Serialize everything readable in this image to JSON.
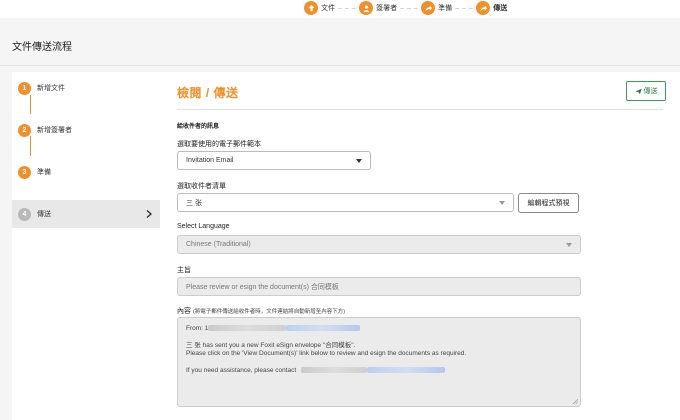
{
  "stepper": {
    "steps": [
      {
        "label": "文件",
        "icon": "document-upload-icon"
      },
      {
        "label": "簽署者",
        "icon": "person-icon"
      },
      {
        "label": "準備",
        "icon": "share-arrow-icon"
      },
      {
        "label": "傳送",
        "icon": "share-arrow-icon"
      }
    ],
    "active_index": 3
  },
  "page_title": "文件傳送流程",
  "sidebar": {
    "items": [
      {
        "num": "1",
        "label": "新增文件"
      },
      {
        "num": "2",
        "label": "新增簽署者"
      },
      {
        "num": "3",
        "label": "準備"
      },
      {
        "num": "4",
        "label": "傳送"
      }
    ]
  },
  "main": {
    "title": "檢閱 / 傳送",
    "send_button": "傳送",
    "recipient_info_label": "給收件者的訊息",
    "email_template": {
      "label": "選取要使用的電子郵件範本",
      "value": "Invitation Email"
    },
    "recipient_list": {
      "label": "選取收件者清單",
      "value": "三 张",
      "edit_button": "編輯程式預視"
    },
    "language": {
      "label": "Select Language",
      "value": "Chinese (Traditional)"
    },
    "subject": {
      "label": "主旨",
      "value": "Please review or esign the document(s) 合同模板"
    },
    "content": {
      "label": "內容",
      "note": "(將電子郵件傳送給收件者時，文件連結將自動新增至內容下方)",
      "from_prefix": "From: 1",
      "line1": "三 张 has sent you a new Foxit eSign envelope \"合同模板\".",
      "line2": "Please click on the 'View Document(s)' link below to review and esign the documents as required.",
      "line3": "If you need assistance, please contact"
    }
  },
  "colors": {
    "accent": "#f0902a",
    "send_green": "#3d9a56"
  }
}
